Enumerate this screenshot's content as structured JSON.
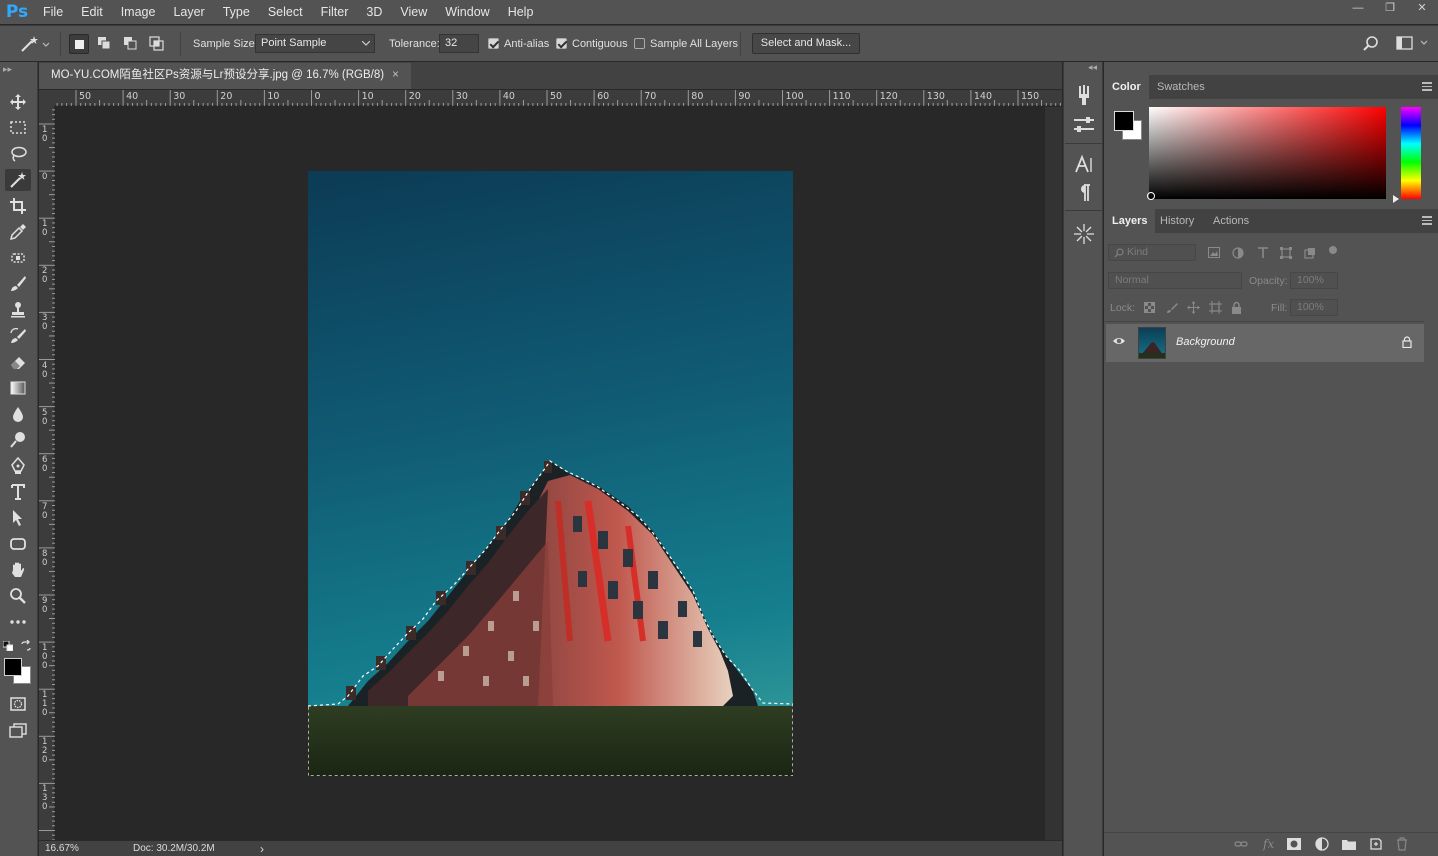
{
  "app": {
    "logo": "Ps"
  },
  "menu": [
    "File",
    "Edit",
    "Image",
    "Layer",
    "Type",
    "Select",
    "Filter",
    "3D",
    "View",
    "Window",
    "Help"
  ],
  "window_controls": {
    "minimize": "—",
    "restore": "❐",
    "close": "✕"
  },
  "options": {
    "sample_size_label": "Sample Size:",
    "sample_size_value": "Point Sample",
    "tolerance_label": "Tolerance:",
    "tolerance_value": "32",
    "anti_alias_label": "Anti-alias",
    "anti_alias_checked": true,
    "contiguous_label": "Contiguous",
    "contiguous_checked": true,
    "sample_all_layers_label": "Sample All Layers",
    "sample_all_layers_checked": false,
    "select_and_mask_label": "Select and Mask..."
  },
  "document": {
    "tab_title": "MO-YU.COM陌鱼社区Ps资源与Lr预设分享.jpg @ 16.7% (RGB/8)",
    "tab_close": "×"
  },
  "rulers": {
    "horizontal": [
      "50",
      "40",
      "30",
      "20",
      "10",
      "0",
      "10",
      "20",
      "30",
      "40",
      "50",
      "60",
      "70",
      "80",
      "90",
      "100",
      "110",
      "120",
      "130",
      "140",
      "150"
    ],
    "vertical": [
      "1 0",
      "0",
      "1 0",
      "2 0",
      "3 0",
      "4 0",
      "5 0",
      "6 0",
      "7 0",
      "8 0",
      "9 0",
      "1 0 0",
      "1 1 0",
      "1 2 0",
      "1 3 0"
    ]
  },
  "status": {
    "zoom": "16.67%",
    "doc": "Doc: 30.2M/30.2M",
    "arrow": "›"
  },
  "color_panel": {
    "tabs": [
      "Color",
      "Swatches"
    ],
    "active_tab": "Color",
    "foreground": "#000000",
    "background": "#ffffff",
    "hue": "#ff0000"
  },
  "layers_panel": {
    "tabs": [
      "Layers",
      "History",
      "Actions"
    ],
    "active_tab": "Layers",
    "filter_placeholder": "Kind",
    "blend_mode": "Normal",
    "opacity_label": "Opacity:",
    "opacity_value": "100%",
    "lock_label": "Lock:",
    "fill_label": "Fill:",
    "fill_value": "100%",
    "layers": [
      {
        "name": "Background",
        "visible": true,
        "locked": true
      }
    ]
  }
}
